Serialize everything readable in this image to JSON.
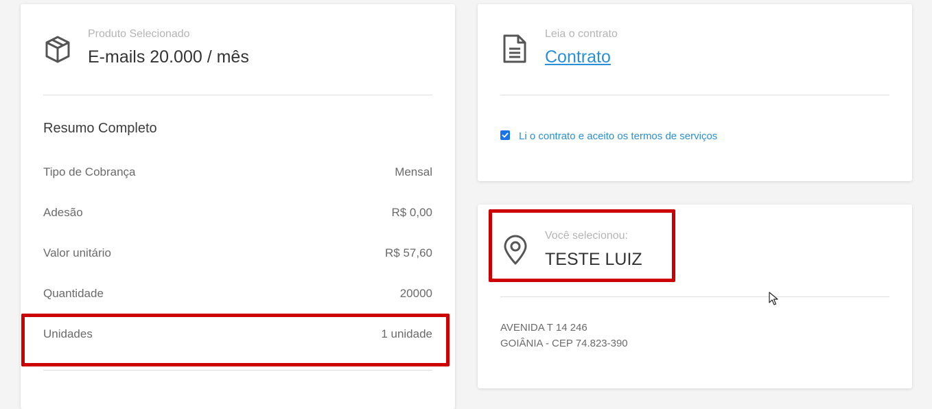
{
  "product": {
    "caption": "Produto Selecionado",
    "name": "E-mails 20.000 / mês",
    "icon": "package-icon"
  },
  "summary": {
    "heading": "Resumo Completo",
    "rows": [
      {
        "label": "Tipo de Cobrança",
        "value": "Mensal"
      },
      {
        "label": "Adesão",
        "value": "R$ 0,00"
      },
      {
        "label": "Valor unitário",
        "value": "R$ 57,60"
      },
      {
        "label": "Quantidade",
        "value": "20000"
      },
      {
        "label": "Unidades",
        "value": "1 unidade"
      }
    ]
  },
  "contract": {
    "caption": "Leia o contrato",
    "link_label": "Contrato",
    "icon": "document-icon",
    "accept_label": "Li o contrato e aceito os termos de serviços",
    "accepted": true
  },
  "address": {
    "caption": "Você selecionou:",
    "name": "TESTE LUIZ",
    "icon": "map-pin-icon",
    "line1": "AVENIDA T 14 246",
    "line2": "GOIÂNIA - CEP 74.823-390"
  },
  "colors": {
    "accent": "#2a8fd6",
    "highlight": "#cc0000",
    "checkbox": "#1a73e8"
  }
}
